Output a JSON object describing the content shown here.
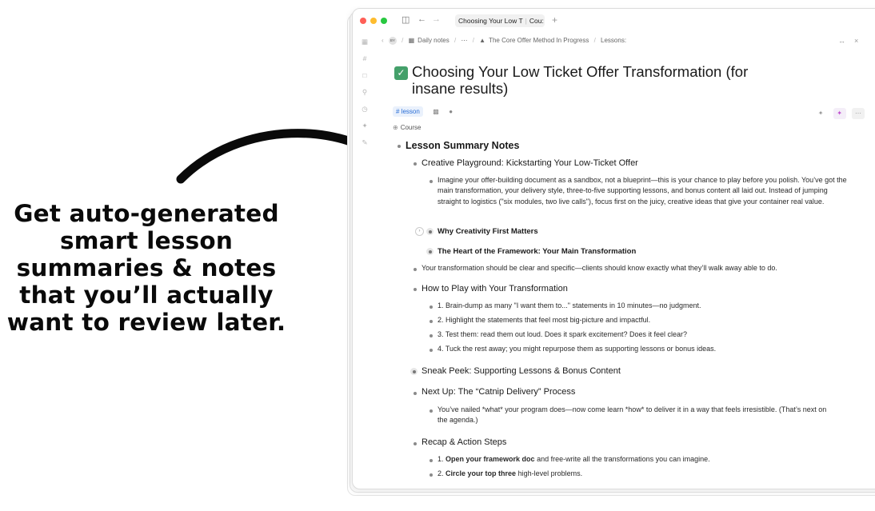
{
  "promo": {
    "lines": [
      "Get auto-generated",
      "smart lesson",
      "summaries & notes",
      "that you’ll actually",
      "want to review later."
    ]
  },
  "window": {
    "tab_title": "Choosing Your Low T",
    "tab_second": "Cou:",
    "breadcrumb": {
      "avatar": "BY",
      "items": [
        "Daily notes",
        "The Core Offer Method In Progress",
        "Lessons:"
      ]
    },
    "page": {
      "title": "Choosing Your Low Ticket Offer Transformation (for insane results)",
      "tag": "# lesson",
      "property_label": "Course",
      "outline": {
        "summary_heading": "Lesson Summary Notes",
        "creative_heading": "Creative Playground: Kickstarting Your Low-Ticket Offer",
        "creative_body": "Imagine your offer-building document as a sandbox, not a blueprint—this is your chance to play before you polish. You’ve got the main transformation, your delivery style, three-to-five supporting lessons, and bonus content all laid out. Instead of jumping straight to logistics (\"six modules, two live calls\"), focus first on the juicy, creative ideas that give your container real value.",
        "why_heading": "Why Creativity First Matters",
        "heart_heading": "The Heart of the Framework: Your Main Transformation",
        "transformation_line": "Your transformation should be clear and specific—clients should know exactly what they’ll walk away able to do.",
        "howto_heading": "How to Play with Your Transformation",
        "howto_steps": [
          "1. Brain-dump as many \"I want them to...\" statements in 10 minutes—no judgment.",
          "2. Highlight the statements that feel most big-picture and impactful.",
          "3. Test them: read them out loud. Does it spark excitement? Does it feel clear?",
          "4. Tuck the rest away; you might repurpose them as supporting lessons or bonus ideas."
        ],
        "sneak_heading": "Sneak Peek: Supporting Lessons & Bonus Content",
        "next_heading": "Next Up: The “Catnip Delivery” Process",
        "next_body": "You’ve nailed *what* your program does—now come learn *how* to deliver it in a way that feels irresistible. (That’s next on the agenda.)",
        "recap_heading": "Recap & Action Steps",
        "recap_1_num": "1.",
        "recap_1_bold": "Open your framework doc",
        "recap_1_rest": " and free-write all the transformations you can imagine.",
        "recap_2_num": "2.",
        "recap_2_bold": "Circle your top three",
        "recap_2_rest": " high-level problems."
      }
    }
  }
}
